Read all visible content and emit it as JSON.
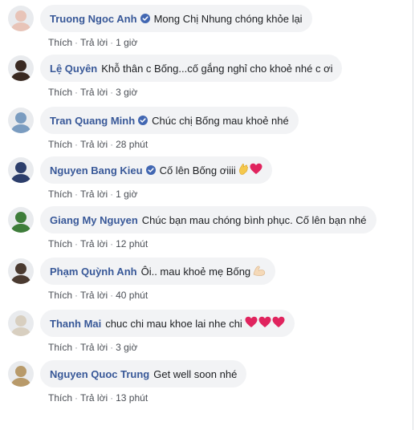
{
  "comments": [
    {
      "name": "Truong Ngoc Anh",
      "verified": true,
      "text": "Mong Chị Nhung chóng khỏe lại",
      "like": "Thích",
      "reply": "Trả lời",
      "time": "1 giờ",
      "avatar_color": "#e8c4b8"
    },
    {
      "name": "Lệ Quyên",
      "verified": false,
      "text": "Khỗ thân c Bống...cố gắng nghỉ cho khoẻ nhé c ơi",
      "like": "Thích",
      "reply": "Trả lời",
      "time": "3 giờ",
      "avatar_color": "#3a2a22"
    },
    {
      "name": "Tran Quang Minh",
      "verified": true,
      "text": "Chúc chị Bống mau khoẻ nhé",
      "like": "Thích",
      "reply": "Trả lời",
      "time": "28 phút",
      "avatar_color": "#7a9cc0"
    },
    {
      "name": "Nguyen Bang Kieu",
      "verified": true,
      "text": "Cố lên Bống ơiiii",
      "emojis": [
        "hand",
        "heart"
      ],
      "like": "Thích",
      "reply": "Trả lời",
      "time": "1 giờ",
      "avatar_color": "#2c3e6b"
    },
    {
      "name": "Giang My Nguyen",
      "verified": false,
      "text": "Chúc bạn mau chóng bình phục. Cố lên bạn nhé",
      "like": "Thích",
      "reply": "Trả lời",
      "time": "12 phút",
      "avatar_color": "#3e7d3a"
    },
    {
      "name": "Phạm Quỳnh Anh",
      "verified": false,
      "text": "Ôi.. mau khoẻ mẹ Bống",
      "emojis": [
        "muscle"
      ],
      "like": "Thích",
      "reply": "Trả lời",
      "time": "40 phút",
      "avatar_color": "#4a3a30"
    },
    {
      "name": "Thanh Mai",
      "verified": false,
      "text": "chuc chi mau khoe lai nhe chi",
      "emojis": [
        "heart",
        "heart",
        "heart"
      ],
      "like": "Thích",
      "reply": "Trả lời",
      "time": "3 giờ",
      "avatar_color": "#d8cfc0"
    },
    {
      "name": "Nguyen Quoc Trung",
      "verified": false,
      "text": "Get well soon nhé",
      "like": "Thích",
      "reply": "Trả lời",
      "time": "13 phút",
      "avatar_color": "#b89a6a"
    }
  ],
  "colors": {
    "name": "#385898",
    "bubble": "#f2f3f5",
    "action": "#90949c",
    "verified": "#4267b2",
    "heart": "#e0245e"
  }
}
